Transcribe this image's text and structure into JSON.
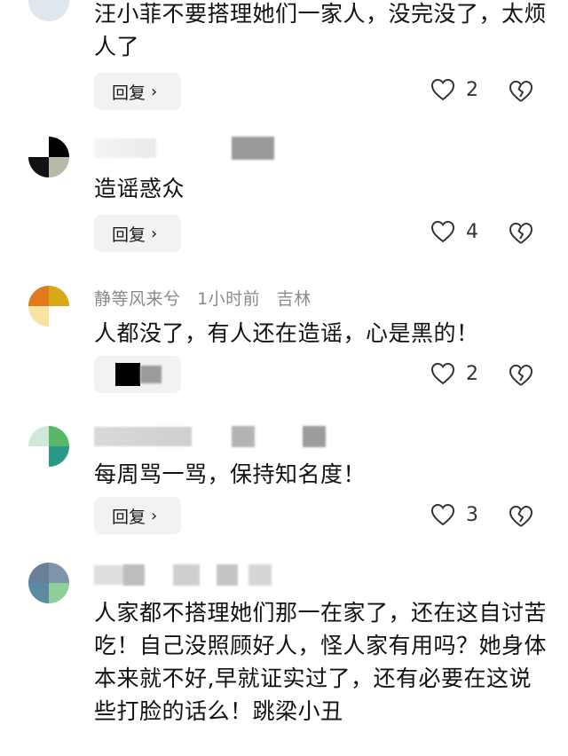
{
  "comments": [
    {
      "author": "",
      "time": "",
      "location": "",
      "text": "汪小菲不要搭理她们一家人，没完没了，太烦人了",
      "reply_label": "回复",
      "likes": "2"
    },
    {
      "author": "",
      "time": "",
      "location": "",
      "text": "造谣惑众",
      "reply_label": "回复",
      "likes": "4"
    },
    {
      "author": "静等风来兮",
      "time": "1小时前",
      "location": "吉林",
      "text": "人都没了，有人还在造谣，心是黑的！",
      "reply_label": "",
      "likes": "2"
    },
    {
      "author": "",
      "time": "",
      "location": "",
      "text": "每周骂一骂，保持知名度！",
      "reply_label": "回复",
      "likes": "3"
    },
    {
      "author": "",
      "time": "",
      "location": "",
      "text": "人家都不搭理她们那一在家了，还在这自讨苦吃！自己没照顾好人，怪人家有用吗？她身体本来就不好,早就证实过了，还有必要在这说些打脸的话么！跳梁小丑",
      "reply_label": "",
      "likes": ""
    }
  ],
  "icons": {
    "like": "heart-outline-icon",
    "dislike": "broken-heart-icon",
    "reply_chevron": "chevron-right-icon"
  },
  "colors": {
    "reply_bg": "#f2f2f2",
    "meta_text": "#8a8a8a",
    "body_text": "#111111"
  }
}
